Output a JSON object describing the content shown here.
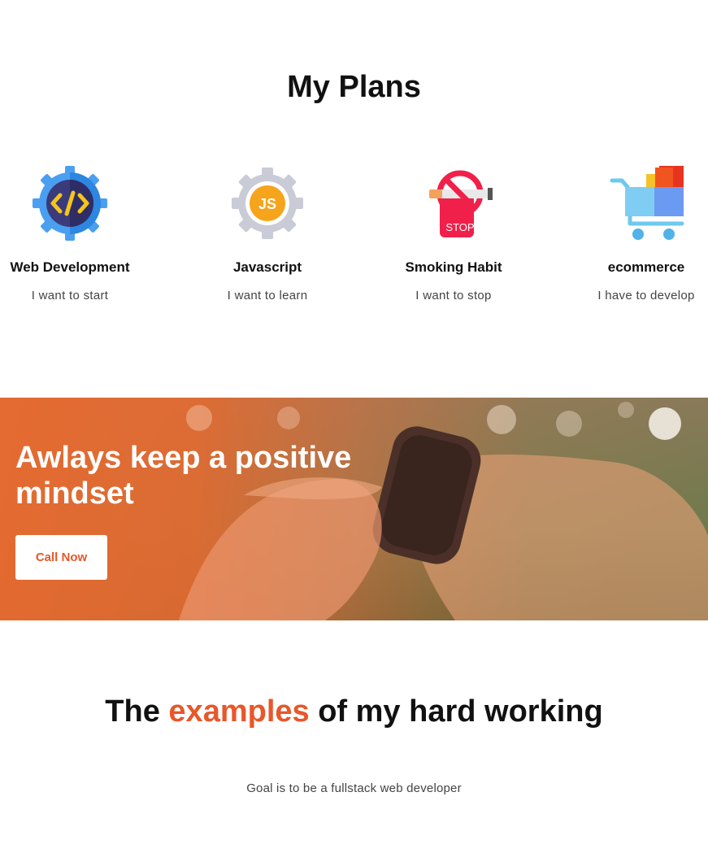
{
  "plans": {
    "title": "My Plans",
    "items": [
      {
        "icon": "code-gear-icon",
        "title": "Web Development",
        "subtitle": "I want to start"
      },
      {
        "icon": "javascript-gear-icon",
        "title": "Javascript",
        "subtitle": "I want to learn"
      },
      {
        "icon": "no-smoking-stop-icon",
        "title": "Smoking Habit",
        "subtitle": "I want to stop",
        "icon_text": "STOP"
      },
      {
        "icon": "shopping-cart-icon",
        "title": "ecommerce",
        "subtitle": "I have to develop"
      }
    ],
    "js_icon_text": "JS"
  },
  "banner": {
    "title": "Awlays keep a positive mindset",
    "button_label": "Call Now",
    "overlay_color": "#e86a30"
  },
  "examples": {
    "title_before": "The ",
    "title_accent": "examples",
    "title_after": " of my hard working",
    "subtitle": "Goal is to be a fullstack web developer",
    "accent_color": "#e8572a"
  }
}
